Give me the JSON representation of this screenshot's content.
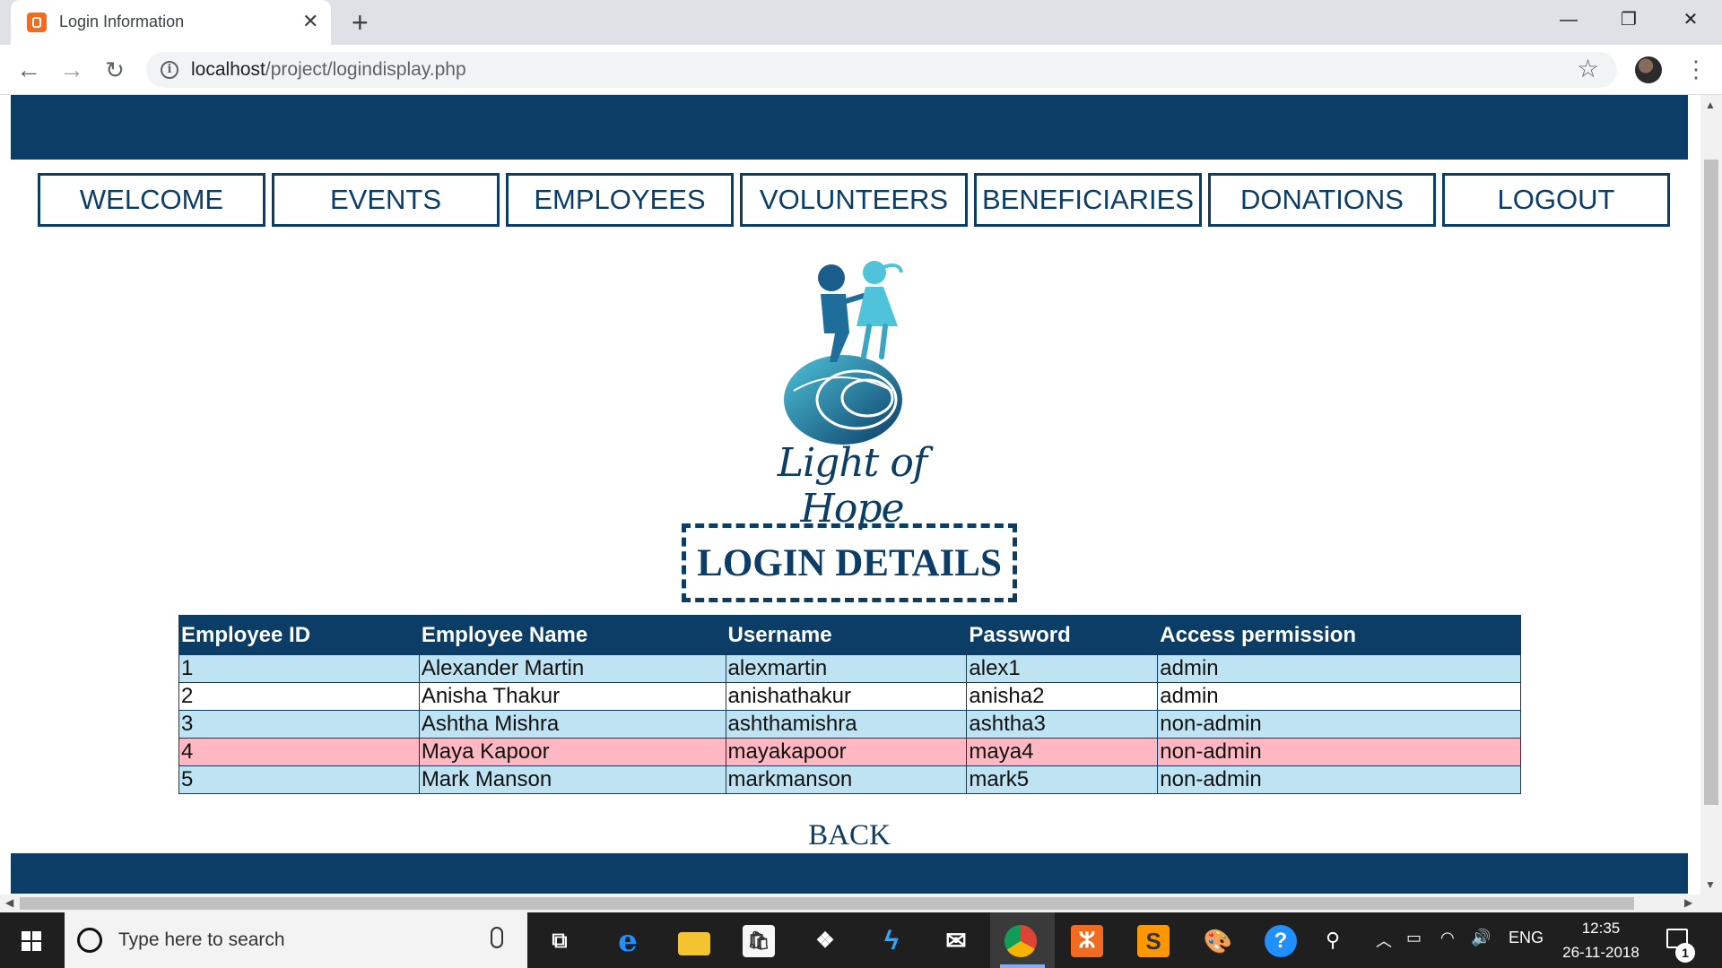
{
  "browser": {
    "tab_title": "Login Information",
    "tab_close": "✕",
    "new_tab": "+",
    "url_host": "localhost",
    "url_path": "/project/logindisplay.php",
    "window_minimize": "—",
    "window_restore": "❐",
    "window_close": "✕"
  },
  "nav": {
    "items": [
      "WELCOME",
      "EVENTS",
      "EMPLOYEES",
      "VOLUNTEERS",
      "BENEFICIARIES",
      "DONATIONS",
      "LOGOUT"
    ]
  },
  "logo": {
    "text": "Light of Hope"
  },
  "page": {
    "heading": "LOGIN DETAILS",
    "back_label": "BACK"
  },
  "table": {
    "headers": [
      "Employee ID",
      "Employee Name",
      "Username",
      "Password",
      "Access permission"
    ],
    "rows": [
      [
        "1",
        "Alexander Martin",
        "alexmartin",
        "alex1",
        "admin"
      ],
      [
        "2",
        "Anisha Thakur",
        "anishathakur",
        "anisha2",
        "admin"
      ],
      [
        "3",
        "Ashtha Mishra",
        "ashthamishra",
        "ashtha3",
        "non-admin"
      ],
      [
        "4",
        "Maya Kapoor",
        "mayakapoor",
        "maya4",
        "non-admin"
      ],
      [
        "5",
        "Mark Manson",
        "markmanson",
        "mark5",
        "non-admin"
      ]
    ]
  },
  "taskbar": {
    "search_placeholder": "Type here to search",
    "language": "ENG",
    "time": "12:35",
    "date": "26-11-2018",
    "notification_count": "1"
  },
  "colors": {
    "brand_navy": "#0b3d67",
    "row_blue": "#bee3f3",
    "row_white": "#ffffff",
    "row_pink": "#ffb8c1"
  }
}
